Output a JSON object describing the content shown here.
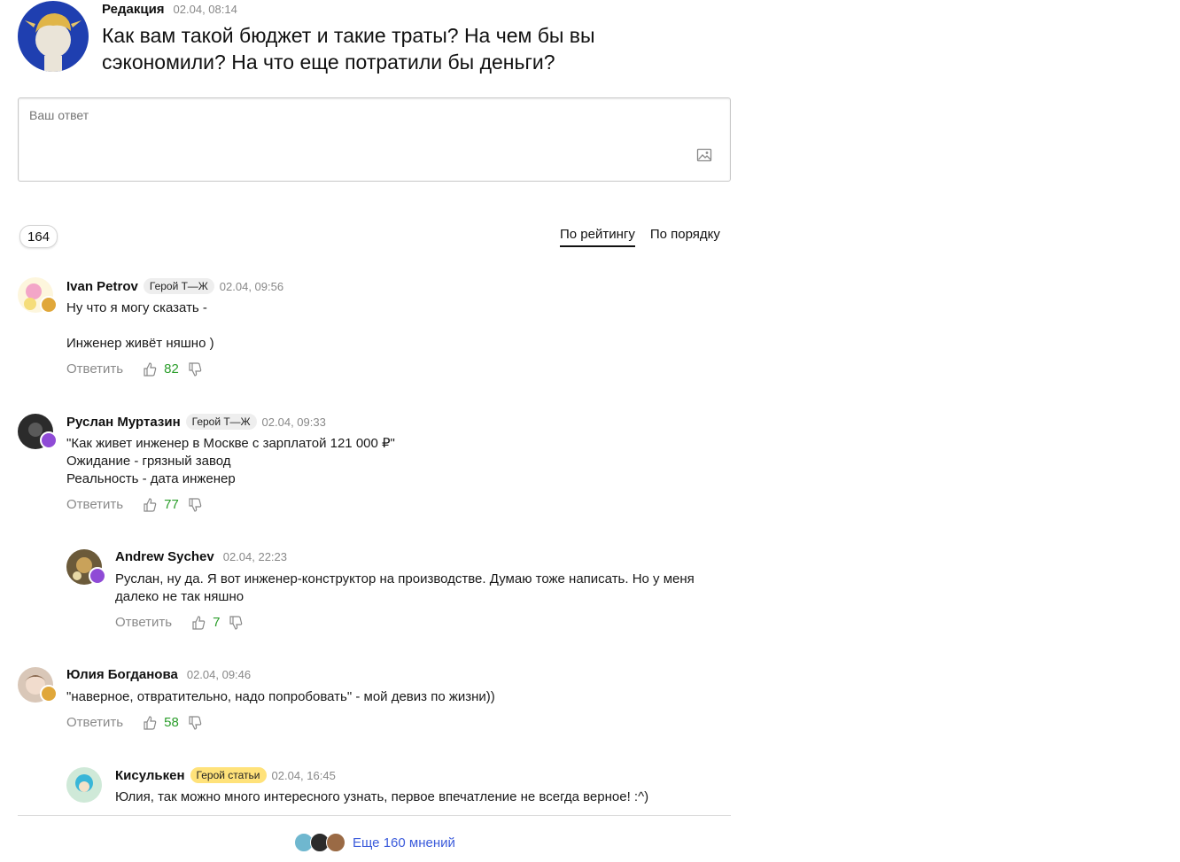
{
  "post": {
    "author": "Редакция",
    "date": "02.04, 08:14",
    "question": "Как вам такой бюджет и такие траты? На чем бы вы сэкономили? На что еще потратили бы деньги?"
  },
  "reply_box": {
    "placeholder": "Ваш ответ"
  },
  "toolbar": {
    "count": "164",
    "sort_rating": "По рейтингу",
    "sort_order": "По порядку"
  },
  "comments": [
    {
      "author": "Ivan Petrov",
      "tag": "Герой Т—Ж",
      "date": "02.04, 09:56",
      "lines": [
        "Ну что я могу сказать -",
        "",
        "Инженер живёт няшно )"
      ],
      "reply": "Ответить",
      "score": "82"
    },
    {
      "author": "Руслан Муртазин",
      "tag": "Герой Т—Ж",
      "date": "02.04, 09:33",
      "lines": [
        "\"Как живет инженер в Москве с зарплатой 121 000 ₽\"",
        "Ожидание - грязный завод",
        "Реальность - дата инженер"
      ],
      "reply": "Ответить",
      "score": "77"
    },
    {
      "author": "Andrew Sychev",
      "tag": "",
      "date": "02.04, 22:23",
      "lines": [
        "Руслан, ну да. Я вот инженер-конструктор на производстве. Думаю тоже написать. Но у меня далеко не так няшно"
      ],
      "reply": "Ответить",
      "score": "7"
    },
    {
      "author": "Юлия Богданова",
      "tag": "",
      "date": "02.04, 09:46",
      "lines": [
        "\"наверное, отвратительно, надо попробовать\" - мой девиз по жизни))"
      ],
      "reply": "Ответить",
      "score": "58"
    },
    {
      "author": "Кисулькен",
      "tag": "Герой статьи",
      "date": "02.04, 16:45",
      "lines": [
        "Юлия, так можно много интересного узнать, первое впечатление не всегда верное! :^)"
      ]
    }
  ],
  "more": {
    "label": "Еще 160 мнений"
  },
  "colors": {
    "score_green": "#2a9d2a",
    "link_blue": "#3b5bdb",
    "hero_tag": "#ffe27a",
    "editor_avatar_bg": "#1f3fb0"
  }
}
